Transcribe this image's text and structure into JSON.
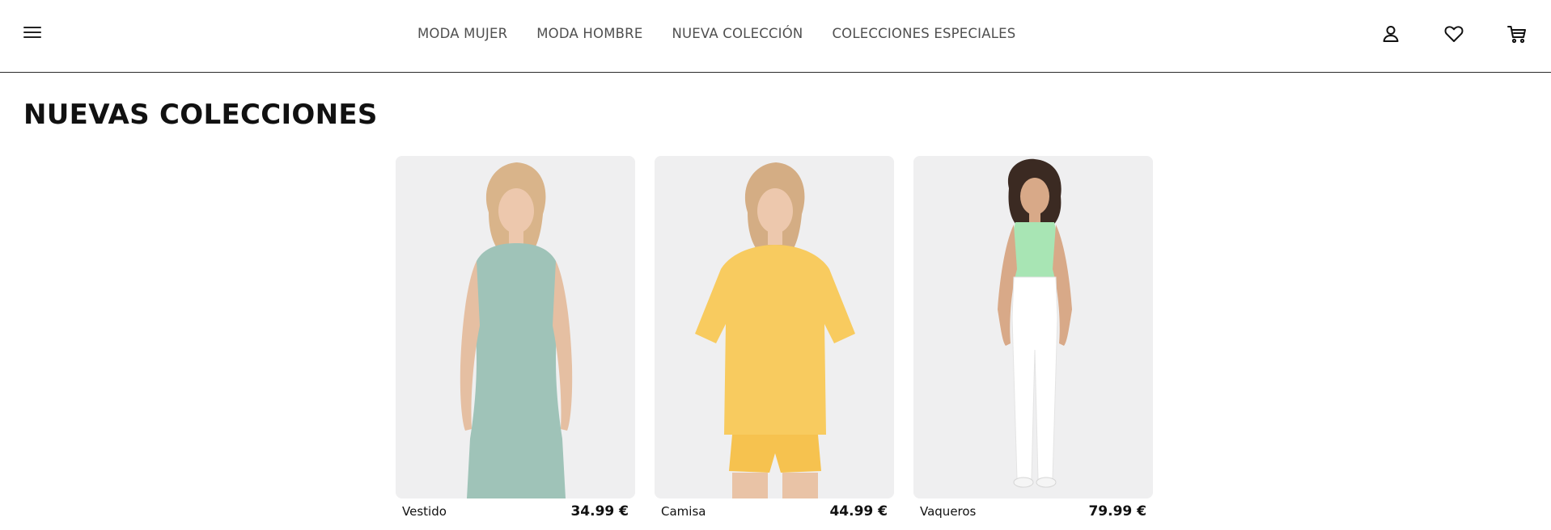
{
  "header": {
    "nav": [
      {
        "label": "MODA MUJER"
      },
      {
        "label": "MODA HOMBRE"
      },
      {
        "label": "NUEVA COLECCIÓN"
      },
      {
        "label": "COLECCIONES ESPECIALES"
      }
    ],
    "icons": [
      "menu-icon",
      "user-icon",
      "heart-icon",
      "cart-icon"
    ]
  },
  "section": {
    "title": "NUEVAS COLECCIONES"
  },
  "products": [
    {
      "name": "Vestido",
      "price": "34.99 €",
      "garment_color": "#9fc3b8"
    },
    {
      "name": "Camisa",
      "price": "44.99 €",
      "garment_color": "#f8cb5f"
    },
    {
      "name": "Vaqueros",
      "price": "79.99 €",
      "garment_color": "#a8e5b4"
    }
  ],
  "colors": {
    "border": "#2a2a2a",
    "image_bg": "#efeff0",
    "nav_text": "#4f4f4f"
  }
}
